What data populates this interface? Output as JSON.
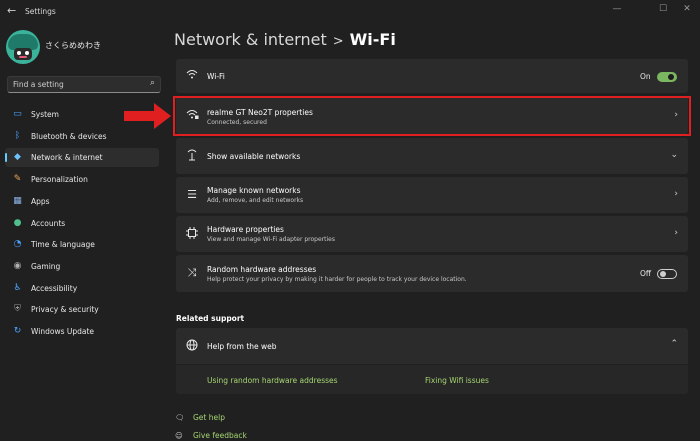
{
  "window": {
    "title": "Settings",
    "back_icon": "back-arrow-icon",
    "controls": [
      "minimize-icon",
      "maximize-icon",
      "close-icon"
    ]
  },
  "user": {
    "name": "さくらめめわき"
  },
  "search": {
    "placeholder": "Find a setting"
  },
  "sidebar": {
    "items": [
      {
        "label": "System",
        "icon": "monitor-icon",
        "color": "#4aa3ff",
        "glyph": "▭"
      },
      {
        "label": "Bluetooth & devices",
        "icon": "bluetooth-icon",
        "color": "#4aa3ff",
        "glyph": "ᛒ"
      },
      {
        "label": "Network & internet",
        "icon": "wifi-network-icon",
        "color": "#6cc4ff",
        "glyph": "◆",
        "active": true
      },
      {
        "label": "Personalization",
        "icon": "paintbrush-icon",
        "color": "#e8a55a",
        "glyph": "✎"
      },
      {
        "label": "Apps",
        "icon": "apps-grid-icon",
        "color": "#8db4e8",
        "glyph": "▦"
      },
      {
        "label": "Accounts",
        "icon": "person-icon",
        "color": "#4fc08d",
        "glyph": "●"
      },
      {
        "label": "Time & language",
        "icon": "globe-clock-icon",
        "color": "#4aa3ff",
        "glyph": "◔"
      },
      {
        "label": "Gaming",
        "icon": "gamepad-icon",
        "color": "#b0b0b0",
        "glyph": "◉"
      },
      {
        "label": "Accessibility",
        "icon": "accessibility-person-icon",
        "color": "#4aa3ff",
        "glyph": "♿"
      },
      {
        "label": "Privacy & security",
        "icon": "shield-icon",
        "color": "#9a9a9a",
        "glyph": "⛨"
      },
      {
        "label": "Windows Update",
        "icon": "update-sync-icon",
        "color": "#4aa3ff",
        "glyph": "↻"
      }
    ]
  },
  "breadcrumb": {
    "parent": "Network & internet",
    "separator": ">",
    "current": "Wi-Fi"
  },
  "wifi_toggle": {
    "label": "Wi-Fi",
    "state": "On"
  },
  "network": {
    "name": "realme GT Neo2T properties",
    "status": "Connected, secured"
  },
  "show_networks": {
    "label": "Show available networks"
  },
  "known_networks": {
    "title": "Manage known networks",
    "subtitle": "Add, remove, and edit networks"
  },
  "hardware": {
    "title": "Hardware properties",
    "subtitle": "View and manage Wi-Fi adapter properties"
  },
  "random_hw": {
    "title": "Random hardware addresses",
    "subtitle": "Help protect your privacy by making it harder for people to track your device location.",
    "state": "Off"
  },
  "related": {
    "title": "Related support",
    "help_label": "Help from the web",
    "links": [
      "Using random hardware addresses",
      "Fixing Wifi issues"
    ]
  },
  "footer": {
    "get_help": "Get help",
    "give_feedback": "Give feedback"
  },
  "colors": {
    "accent": "#60cdff",
    "toggle_on": "#7bb661",
    "highlight": "#e02020",
    "link": "#a6d672"
  }
}
